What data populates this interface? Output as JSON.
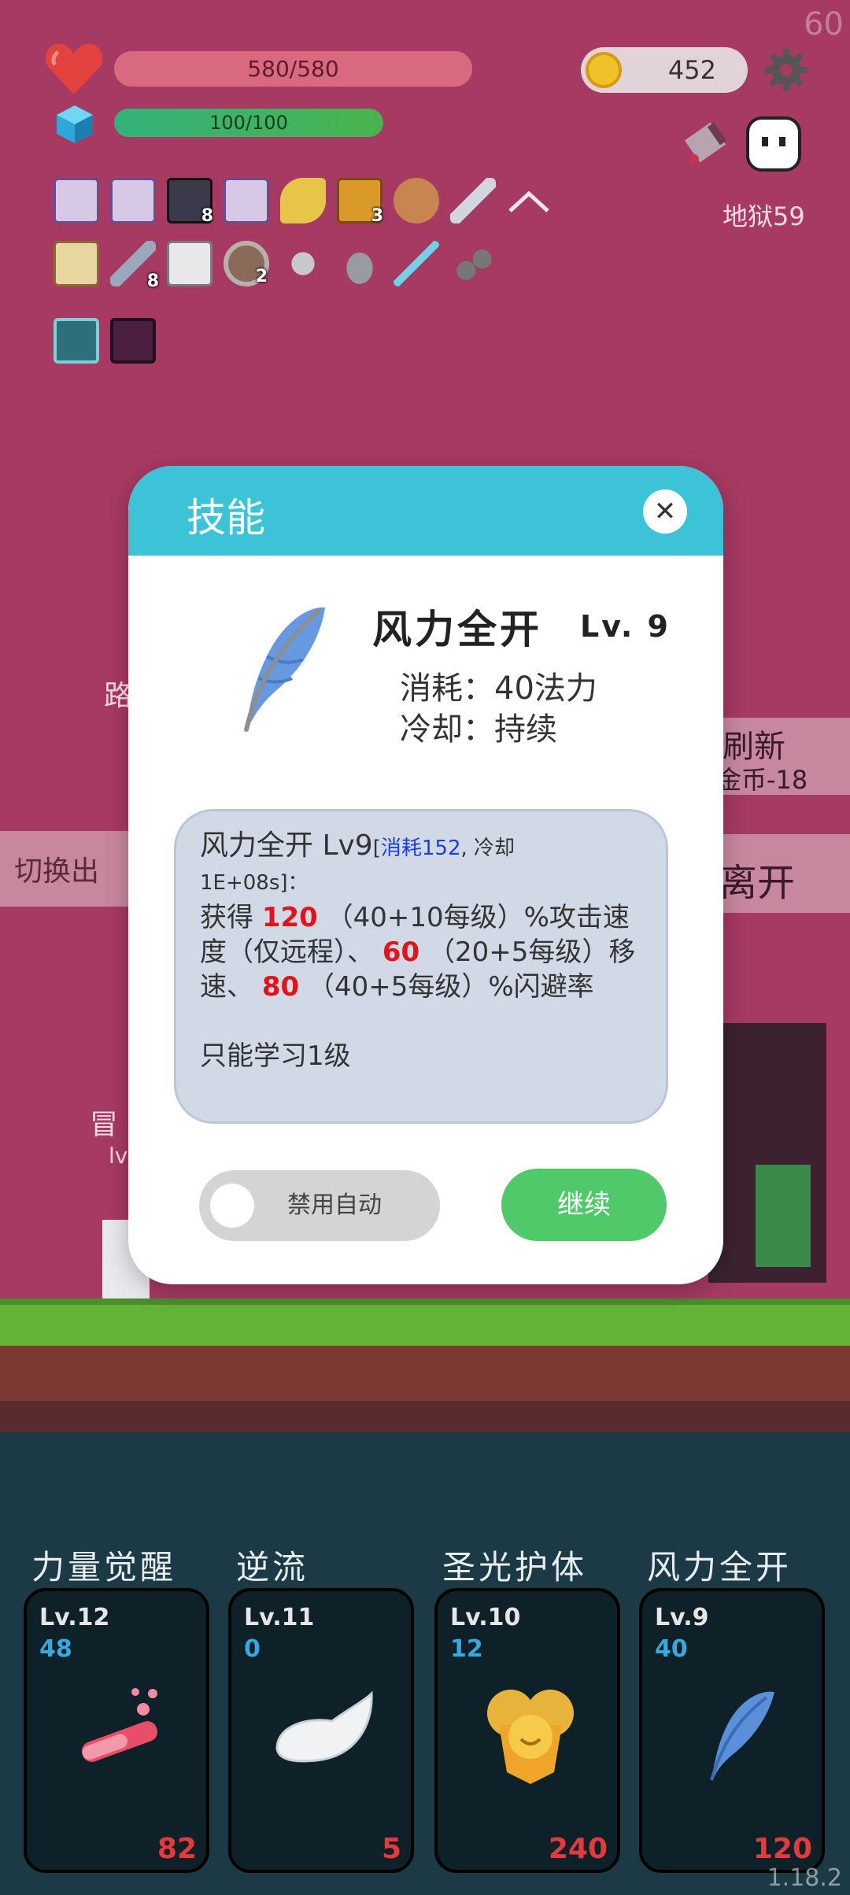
{
  "hud": {
    "fps": "60",
    "hp_text": "580/580",
    "mp_text": "100/100",
    "coins": "452",
    "hell_level": "地狱59"
  },
  "inventory": {
    "row1": [
      {
        "name": "scroll-icon",
        "count": ""
      },
      {
        "name": "scroll-icon",
        "count": ""
      },
      {
        "name": "skull-book-icon",
        "count": "8"
      },
      {
        "name": "scroll-icon",
        "count": ""
      },
      {
        "name": "magic-wand-icon",
        "count": ""
      },
      {
        "name": "spell-book-icon",
        "count": "3"
      },
      {
        "name": "meat-icon",
        "count": ""
      },
      {
        "name": "sword-icon",
        "count": ""
      }
    ],
    "row2": [
      {
        "name": "map-icon",
        "count": ""
      },
      {
        "name": "sword-icon",
        "count": "8"
      },
      {
        "name": "envelope-icon",
        "count": ""
      },
      {
        "name": "shield-icon",
        "count": "2"
      },
      {
        "name": "mace-icon",
        "count": ""
      },
      {
        "name": "viking-helmet-icon",
        "count": ""
      },
      {
        "name": "dagger-icon",
        "count": ""
      },
      {
        "name": "bombs-icon",
        "count": ""
      }
    ],
    "row3": [
      {
        "name": "lightbulb-rune-icon",
        "count": ""
      },
      {
        "name": "demon-rune-icon",
        "count": ""
      }
    ]
  },
  "background": {
    "left_partial_1": "路",
    "left_partial_2": "切换出",
    "left_partial_3": "冒",
    "left_partial_4": "lv",
    "right_refresh": "刷新",
    "right_refresh_cost": "金币-18",
    "right_leave": "离开"
  },
  "modal": {
    "title": "技能",
    "skill_name": "风力全开",
    "skill_level": "Lv. 9",
    "cost_line": "消耗：40法力",
    "cooldown_line": "冷却：持续",
    "desc": {
      "head": "风力全开  Lv9",
      "bracket_open": "[",
      "cost_blue": "消耗152",
      "cooldown_small": ", 冷却",
      "cooldown_value": "1E+08s]：",
      "gain_prefix": "获得",
      "value1": "120",
      "part1": "（40+10每级）%攻击速度（仅远程）、",
      "value2": "60",
      "part2": "（20+5每级）移速、",
      "value3": "80",
      "part3": "（40+5每级）%闪避率",
      "note": "只能学习1级"
    },
    "auto_toggle_label": "禁用自动",
    "continue_label": "继续"
  },
  "skills": [
    {
      "name": "力量觉醒",
      "level": "Lv.12",
      "cost": "48",
      "value": "82",
      "icon": "potion-icon"
    },
    {
      "name": "逆流",
      "level": "Lv.11",
      "cost": "0",
      "value": "5",
      "icon": "wing-icon"
    },
    {
      "name": "圣光护体",
      "level": "Lv.10",
      "cost": "12",
      "value": "240",
      "icon": "holy-shield-icon"
    },
    {
      "name": "风力全开",
      "level": "Lv.9",
      "cost": "40",
      "value": "120",
      "icon": "feather-icon"
    }
  ],
  "version": "1.18.2",
  "colors": {
    "background": "#a63a62",
    "modal_header": "#3cc3d7",
    "continue_button": "#4fc96a",
    "highlight_red": "#e0141a",
    "highlight_blue": "#1a3fd8"
  }
}
